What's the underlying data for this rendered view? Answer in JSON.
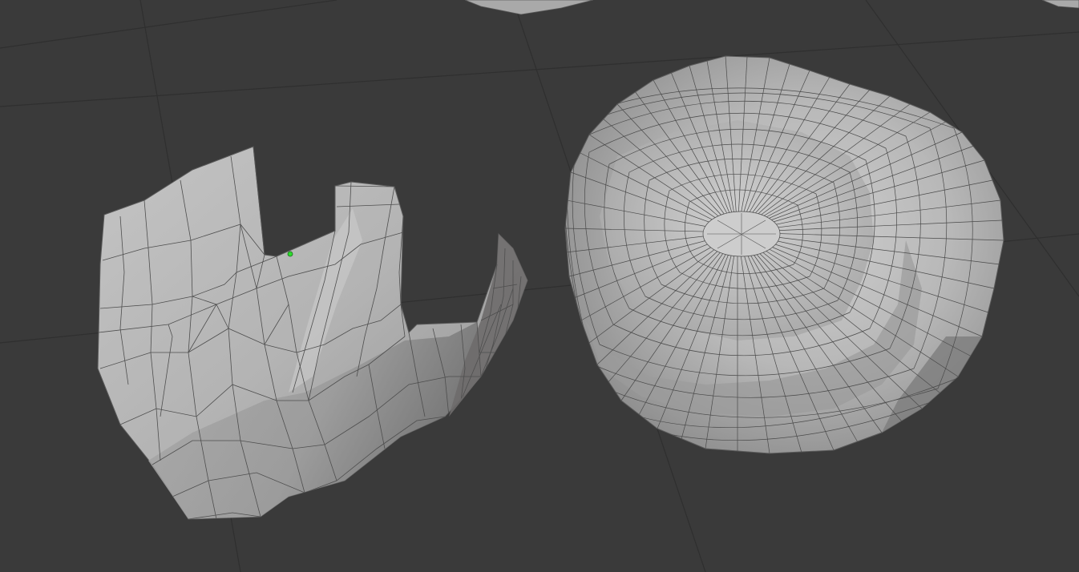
{
  "viewport": {
    "background": "#3a3a3a",
    "grid_color": "#2e2e2e",
    "mesh_surface_color": "#b9b9b9",
    "mesh_wire_color": "#505050",
    "selected_vertex_color": "#2ddc2d"
  },
  "objects": [
    {
      "name_icon": "open-mesh-shell-icon",
      "kind": "open-hand-shaped-mesh"
    },
    {
      "name_icon": "closed-blob-mesh-icon",
      "kind": "deformed-rounded-blob-mesh"
    }
  ]
}
